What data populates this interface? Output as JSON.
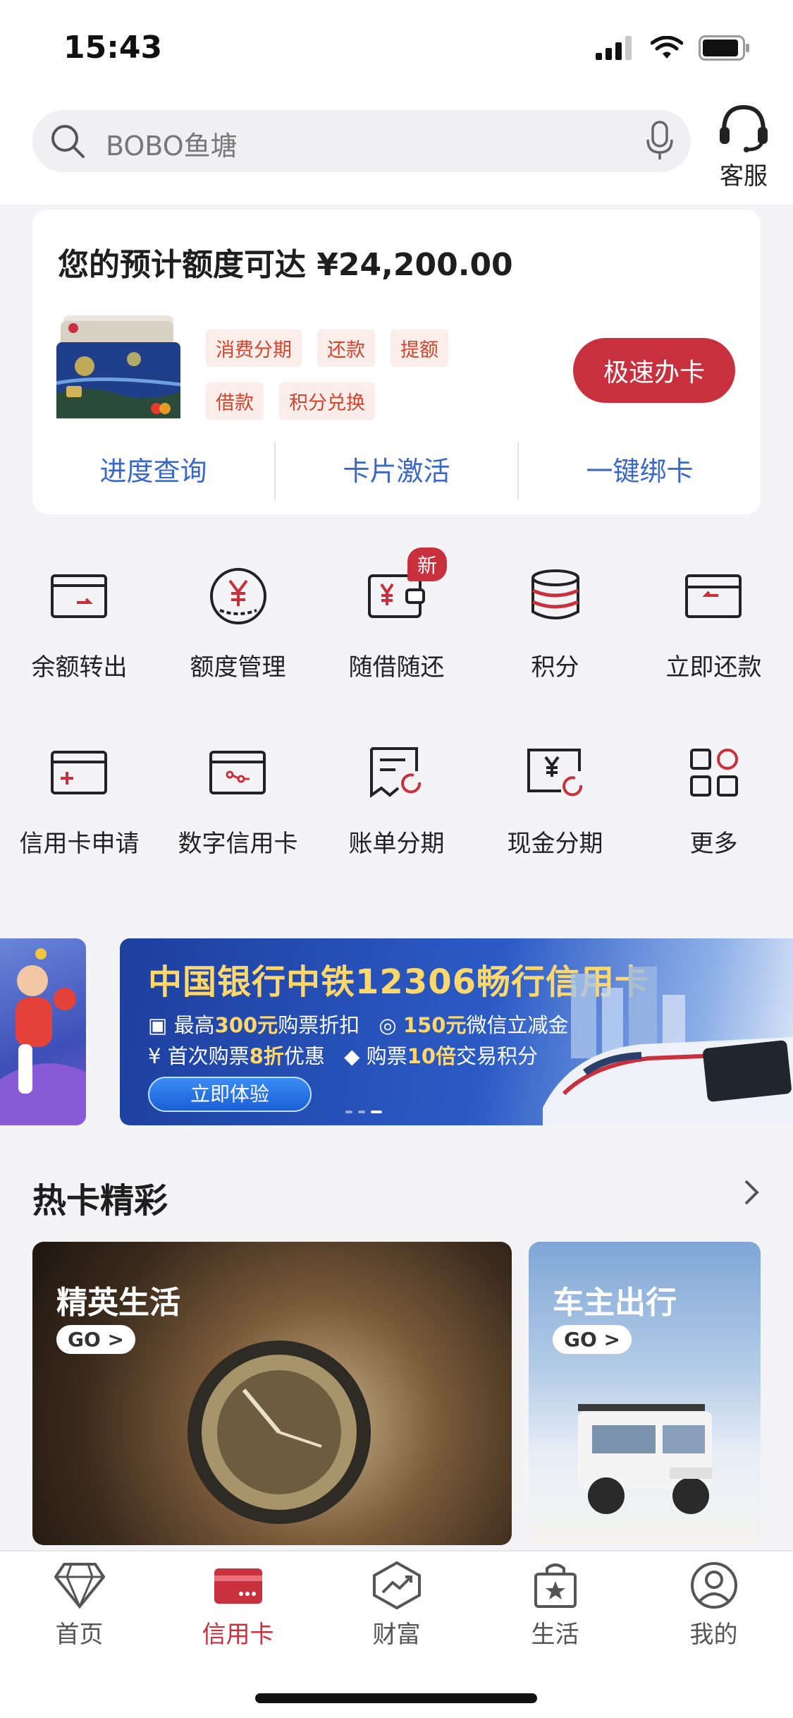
{
  "status_bar": {
    "time": "15:43"
  },
  "search": {
    "placeholder": "BOBO鱼塘",
    "service_label": "客服"
  },
  "card_panel": {
    "quota_text": "您的预计额度可达 ¥24,200.00",
    "tags": [
      "消费分期",
      "还款",
      "提额",
      "借款",
      "积分兑换"
    ],
    "apply_button": "极速办卡",
    "links": [
      "进度查询",
      "卡片激活",
      "一键绑卡"
    ]
  },
  "grid": {
    "row1": [
      {
        "label": "余额转出",
        "icon": "transfer-out-icon"
      },
      {
        "label": "额度管理",
        "icon": "yen-circle-icon"
      },
      {
        "label": "随借随还",
        "icon": "wallet-yen-icon",
        "badge": "新"
      },
      {
        "label": "积分",
        "icon": "coins-stack-icon"
      },
      {
        "label": "立即还款",
        "icon": "repay-card-icon"
      }
    ],
    "row2": [
      {
        "label": "信用卡申请",
        "icon": "card-plus-icon"
      },
      {
        "label": "数字信用卡",
        "icon": "digital-card-icon"
      },
      {
        "label": "账单分期",
        "icon": "bill-installment-icon"
      },
      {
        "label": "现金分期",
        "icon": "cash-installment-icon"
      },
      {
        "label": "更多",
        "icon": "more-grid-icon"
      }
    ]
  },
  "banner": {
    "title": "中国银行中铁12306畅行信用卡",
    "line1_a": "最高",
    "line1_b": "300元",
    "line1_c": "购票折扣",
    "line1_d": "150元",
    "line1_e": "微信立减金",
    "line2_a": "首次购票",
    "line2_b": "8折",
    "line2_c": "优惠",
    "line2_d": "购票",
    "line2_e": "10倍",
    "line2_f": "交易积分",
    "button": "立即体验"
  },
  "hot": {
    "title": "热卡精彩",
    "cards": [
      {
        "title": "精英生活",
        "go": "GO >"
      },
      {
        "title": "车主出行",
        "go": "GO >"
      }
    ]
  },
  "tabbar": {
    "tabs": [
      {
        "label": "首页",
        "icon": "diamond-icon",
        "active": false
      },
      {
        "label": "信用卡",
        "icon": "credit-card-icon",
        "active": true
      },
      {
        "label": "财富",
        "icon": "wealth-chart-icon",
        "active": false
      },
      {
        "label": "生活",
        "icon": "shopping-bag-icon",
        "active": false
      },
      {
        "label": "我的",
        "icon": "user-profile-icon",
        "active": false
      }
    ]
  },
  "colors": {
    "accent": "#c9303d",
    "link_blue": "#3a68c7",
    "tag_text": "#d2442c"
  }
}
